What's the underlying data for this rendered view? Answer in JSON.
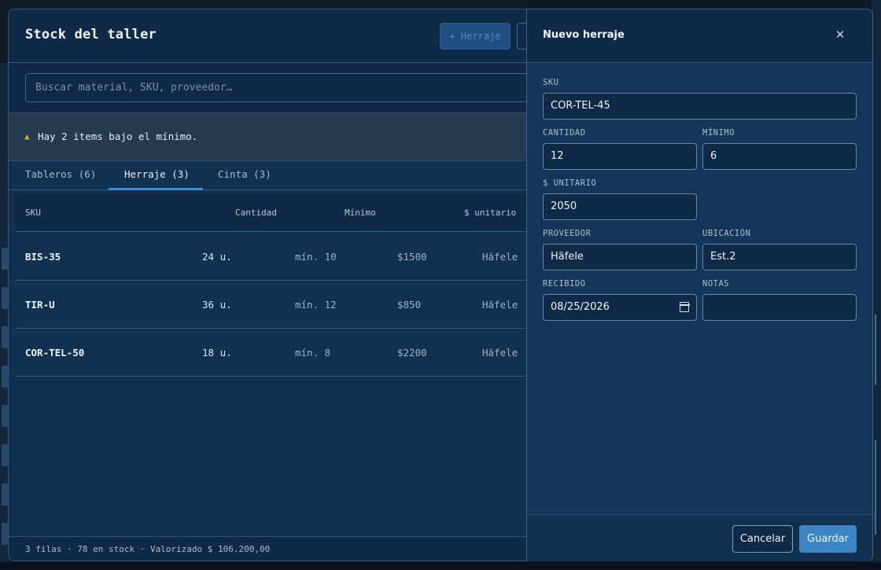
{
  "dialog": {
    "title": "Stock del taller",
    "add_button_label": "+ Herraje",
    "search": {
      "placeholder": "Buscar material, SKU, proveedor…",
      "value": ""
    },
    "alert": {
      "icon": "warning-icon",
      "text": "Hay 2 items bajo el mínimo."
    },
    "tabs": [
      {
        "label": "Tableros (6)",
        "active": false
      },
      {
        "label": "Herraje (3)",
        "active": true
      },
      {
        "label": "Cinta (3)",
        "active": false
      }
    ],
    "table": {
      "headers": {
        "sku": "SKU",
        "cantidad": "Cantidad",
        "minimo": "Mínimo",
        "unitario": "$ unitario"
      },
      "rows": [
        {
          "sku": "BIS-35",
          "cantidad": "24 u.",
          "minimo": "mín. 10",
          "precio": "$1500",
          "proveedor": "Häfele"
        },
        {
          "sku": "TIR-U",
          "cantidad": "36 u.",
          "minimo": "mín. 12",
          "precio": "$850",
          "proveedor": "Häfele"
        },
        {
          "sku": "COR-TEL-50",
          "cantidad": "18 u.",
          "minimo": "mín. 8",
          "precio": "$2200",
          "proveedor": "Häfele"
        }
      ]
    },
    "footer": "3 filas · 78 en stock · Valorizado $ 106.200,00"
  },
  "panel": {
    "title": "Nuevo herraje",
    "close_icon": "close-icon",
    "fields": {
      "sku": {
        "label": "SKU",
        "value": "COR-TEL-45"
      },
      "cantidad": {
        "label": "CANTIDAD",
        "value": "12"
      },
      "minimo": {
        "label": "MÍNIMO",
        "value": "6"
      },
      "unitario": {
        "label": "$ UNITARIO",
        "value": "2050"
      },
      "proveedor": {
        "label": "PROVEEDOR",
        "value": "Häfele"
      },
      "ubicacion": {
        "label": "UBICACIÓN",
        "value": "Est.2"
      },
      "recibido": {
        "label": "RECIBIDO",
        "value": "08/25/2026"
      },
      "notas": {
        "label": "NOTAS",
        "value": ""
      }
    },
    "cancel_label": "Cancelar",
    "save_label": "Guardar"
  },
  "colors": {
    "accent": "#3d86c6",
    "warning": "#e0a84a",
    "panel_bg": "#15365a"
  }
}
